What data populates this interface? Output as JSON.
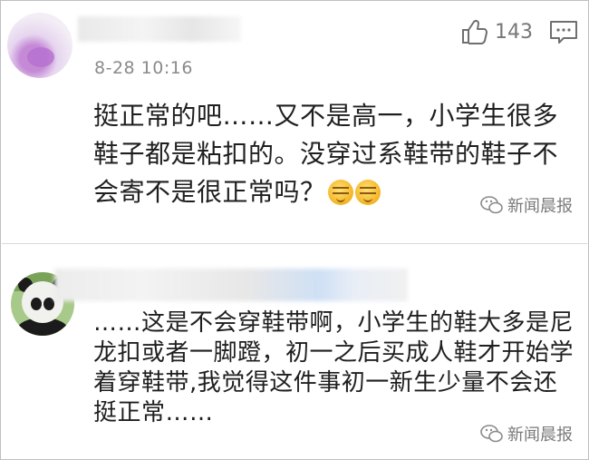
{
  "comments": [
    {
      "time": "8-28 10:16",
      "likes": "143",
      "text": "挺正常的吧……又不是高一，小学生很多鞋子都是粘扣的。没穿过系鞋带的鞋子不会寄不是很正常吗？",
      "emoji": [
        "grimace-emoji",
        "grimace-emoji"
      ]
    },
    {
      "text": "……这是不会穿鞋带啊，小学生的鞋大多是尼龙扣或者一脚蹬，初一之后买成人鞋才开始学着穿鞋带,我觉得这件事初一新生少量不会还挺正常……"
    }
  ],
  "watermark": "新闻晨报",
  "icons": {
    "like": "thumbs-up-icon",
    "reply": "comment-icon",
    "watermark": "wechat-icon"
  },
  "colors": {
    "meta_text": "#8a8a8a",
    "body_text": "#1f1f1f",
    "emoji": "#f4b322"
  }
}
